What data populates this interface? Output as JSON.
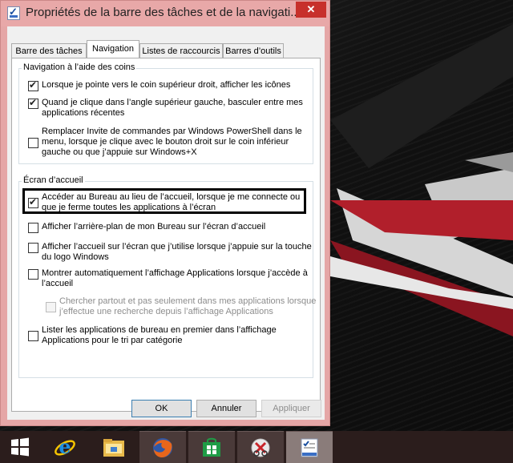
{
  "window": {
    "title": "Propriétés de la barre des tâches et de la navigati...",
    "close_label": "✕"
  },
  "tabs": [
    {
      "label": "Barre des tâches",
      "active": false
    },
    {
      "label": "Navigation",
      "active": true
    },
    {
      "label": "Listes de raccourcis",
      "active": false
    },
    {
      "label": "Barres d’outils",
      "active": false
    }
  ],
  "corner_navigation": {
    "label": "Navigation à l’aide des coins",
    "options": [
      {
        "lines": [
          "Lorsque je pointe vers le coin supérieur droit, afficher les icônes"
        ],
        "checked": true
      },
      {
        "lines": [
          "Quand je clique dans l’angle supérieur gauche, basculer entre mes",
          "applications récentes"
        ],
        "checked": true
      },
      {
        "lines": [
          "Remplacer Invite de commandes par Windows PowerShell dans le",
          "menu, lorsque je clique avec le bouton droit sur le coin inférieur",
          "gauche ou que j’appuie sur Windows+X"
        ],
        "checked": false
      }
    ]
  },
  "start_screen": {
    "label": "Écran d’accueil",
    "options": [
      {
        "lines": [
          "Accéder au Bureau au lieu de l’accueil, lorsque je me connecte ou",
          "que je ferme toutes les applications à l’écran"
        ],
        "checked": true
      },
      {
        "lines": [
          "Afficher l’arrière-plan de mon Bureau sur l’écran d’accueil"
        ],
        "checked": false
      },
      {
        "lines": [
          "Afficher l’accueil sur l’écran que j’utilise lorsque j’appuie sur la touche",
          "du logo Windows"
        ],
        "checked": false
      },
      {
        "lines": [
          "Montrer automatiquement l’affichage Applications lorsque j’accède à",
          "l’accueil"
        ],
        "checked": false
      },
      {
        "lines": [
          "Chercher partout et pas seulement dans mes applications lorsque",
          "j’effectue une recherche depuis l’affichage Applications"
        ],
        "checked": false,
        "disabled": true
      },
      {
        "lines": [
          "Lister les applications de bureau en premier dans l’affichage",
          "Applications pour le tri par catégorie"
        ],
        "checked": false
      }
    ]
  },
  "buttons": {
    "ok": "OK",
    "cancel": "Annuler",
    "apply": "Appliquer"
  },
  "taskbar": {
    "items": [
      {
        "icon": "windows-start-icon"
      },
      {
        "icon": "internet-explorer-icon"
      },
      {
        "icon": "file-explorer-icon"
      },
      {
        "icon": "firefox-icon"
      },
      {
        "icon": "windows-store-icon"
      },
      {
        "icon": "snipping-tool-icon"
      },
      {
        "icon": "taskbar-properties-icon"
      }
    ]
  },
  "colors": {
    "title_bar": "#e8a8a8",
    "close_button": "#c7302b",
    "taskbar": "#2b1d1c"
  }
}
